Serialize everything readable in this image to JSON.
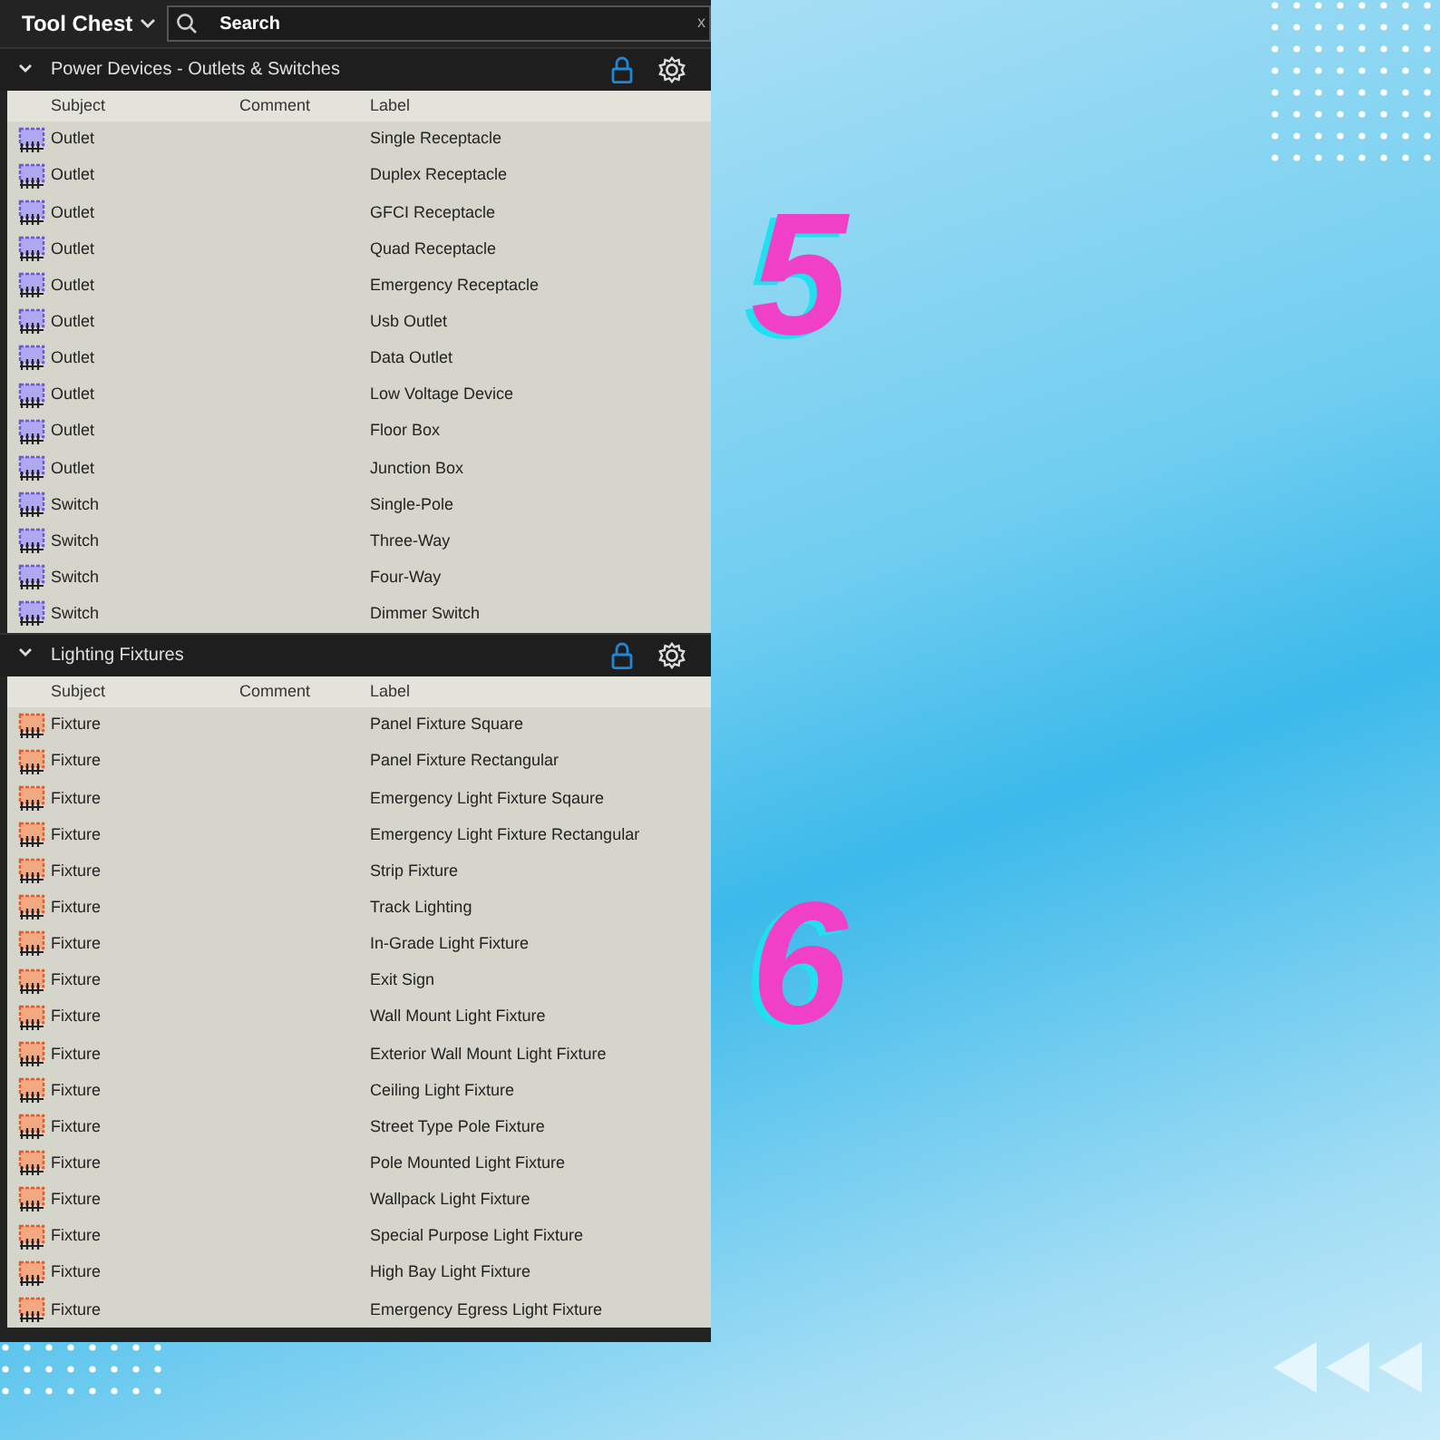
{
  "panel": {
    "title": "Tool Chest",
    "search": {
      "placeholder": "Search",
      "clear": "x"
    }
  },
  "sections": [
    {
      "title": "Power Devices - Outlets & Switches",
      "expanded": true,
      "columns": [
        "Subject",
        "Comment",
        "Label"
      ],
      "rows": [
        {
          "subject": "Outlet",
          "label": "Single Receptacle"
        },
        {
          "subject": "Outlet",
          "label": "Duplex Receptacle"
        },
        {
          "subject": "Outlet",
          "label": "GFCI Receptacle"
        },
        {
          "subject": "Outlet",
          "label": "Quad Receptacle"
        },
        {
          "subject": "Outlet",
          "label": "Emergency Receptacle"
        },
        {
          "subject": "Outlet",
          "label": "Usb Outlet"
        },
        {
          "subject": "Outlet",
          "label": "Data Outlet"
        },
        {
          "subject": "Outlet",
          "label": "Low Voltage Device"
        },
        {
          "subject": "Outlet",
          "label": "Floor Box"
        },
        {
          "subject": "Outlet",
          "label": "Junction Box"
        },
        {
          "subject": "Switch",
          "label": "Single-Pole"
        },
        {
          "subject": "Switch",
          "label": "Three-Way"
        },
        {
          "subject": "Switch",
          "label": "Four-Way"
        },
        {
          "subject": "Switch",
          "label": "Dimmer Switch"
        }
      ]
    },
    {
      "title": "Lighting Fixtures",
      "expanded": true,
      "columns": [
        "Subject",
        "Comment",
        "Label"
      ],
      "rows": [
        {
          "subject": "Fixture",
          "label": "Panel Fixture Square"
        },
        {
          "subject": "Fixture",
          "label": "Panel Fixture Rectangular"
        },
        {
          "subject": "Fixture",
          "label": "Emergency Light Fixture Sqaure"
        },
        {
          "subject": "Fixture",
          "label": "Emergency Light Fixture Rectangular"
        },
        {
          "subject": "Fixture",
          "label": "Strip Fixture"
        },
        {
          "subject": "Fixture",
          "label": "Track Lighting"
        },
        {
          "subject": "Fixture",
          "label": "In-Grade Light Fixture"
        },
        {
          "subject": "Fixture",
          "label": "Exit Sign"
        },
        {
          "subject": "Fixture",
          "label": "Wall Mount Light Fixture"
        },
        {
          "subject": "Fixture",
          "label": "Exterior Wall Mount Light Fixture"
        },
        {
          "subject": "Fixture",
          "label": "Ceiling Light Fixture"
        },
        {
          "subject": "Fixture",
          "label": "Street Type Pole Fixture"
        },
        {
          "subject": "Fixture",
          "label": "Pole Mounted Light Fixture"
        },
        {
          "subject": "Fixture",
          "label": "Wallpack Light Fixture"
        },
        {
          "subject": "Fixture",
          "label": "Special Purpose Light Fixture"
        },
        {
          "subject": "Fixture",
          "label": "High Bay Light Fixture"
        },
        {
          "subject": "Fixture",
          "label": "Emergency Egress Light Fixture"
        }
      ]
    }
  ],
  "step_numbers": [
    "5",
    "6"
  ]
}
